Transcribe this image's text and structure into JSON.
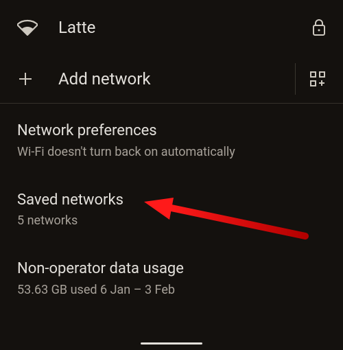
{
  "wifi": {
    "ssid": "Latte",
    "secured": true
  },
  "add_network": {
    "label": "Add network"
  },
  "settings": [
    {
      "title": "Network preferences",
      "subtitle": "Wi-Fi doesn't turn back on automatically"
    },
    {
      "title": "Saved networks",
      "subtitle": "5 networks"
    },
    {
      "title": "Non-operator data usage",
      "subtitle": "53.63 GB used 6 Jan – 3 Feb"
    }
  ]
}
